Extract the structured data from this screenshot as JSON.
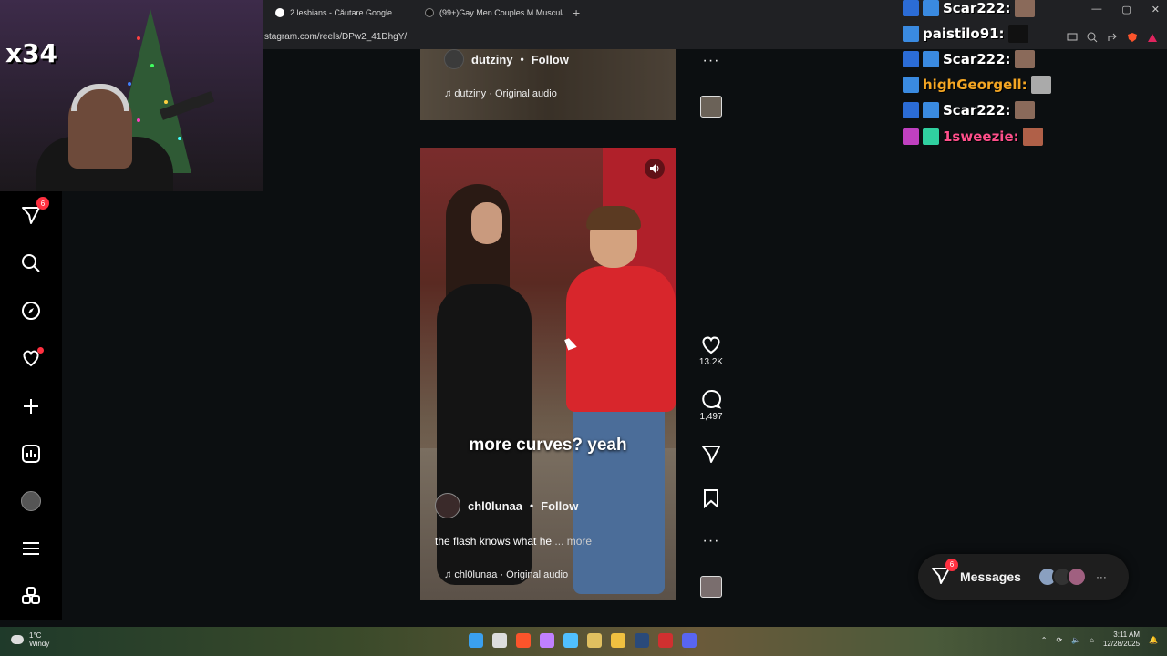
{
  "browser": {
    "tabs": [
      {
        "label": "2 lesbians - Căutare Google",
        "favicon_color": "#ffffff"
      },
      {
        "label": "(99+)Gay Men Couples M Muscular |",
        "favicon_color": "#111111"
      }
    ],
    "new_tab": "+",
    "url": "stagram.com/reels/DPw2_41DhgY/",
    "window_controls": [
      "—",
      "▢",
      "✕"
    ]
  },
  "stream_overlay": {
    "multiplier": "x34"
  },
  "sidebar": {
    "items": [
      {
        "name": "direct-icon",
        "badge": "6"
      },
      {
        "name": "search-icon"
      },
      {
        "name": "explore-icon"
      },
      {
        "name": "notifications-icon"
      },
      {
        "name": "create-icon"
      },
      {
        "name": "dashboard-icon"
      },
      {
        "name": "profile-avatar"
      },
      {
        "name": "menu-icon"
      },
      {
        "name": "apps-icon"
      }
    ]
  },
  "previous_reel": {
    "username": "dutziny",
    "separator": "•",
    "follow": "Follow",
    "audio": "dutziny · Original audio"
  },
  "reel": {
    "caption_overlay": "more curves? yeah",
    "username": "chl0lunaa",
    "separator": "•",
    "follow": "Follow",
    "description": "the flash knows what he",
    "more": "... more",
    "audio": "chl0lunaa · Original audio",
    "likes": "13.2K",
    "comments": "1,497"
  },
  "chat": [
    {
      "user": "Scar222:",
      "color": "#ffffff"
    },
    {
      "user": "paistilo91:",
      "color": "#ffffff"
    },
    {
      "user": "Scar222:",
      "color": "#ffffff"
    },
    {
      "user": "highGeorgell:",
      "color": "#f5a623"
    },
    {
      "user": "Scar222:",
      "color": "#ffffff"
    },
    {
      "user": "1sweezie:",
      "color": "#ff4f8b"
    }
  ],
  "messages": {
    "label": "Messages",
    "badge": "6",
    "more": "···"
  },
  "taskbar": {
    "temperature": "1°C",
    "weather": "Windy",
    "time": "3:11 AM",
    "date": "12/28/2025"
  },
  "colors": {
    "badge": "#ff3040",
    "accent_red": "#d8262c"
  }
}
